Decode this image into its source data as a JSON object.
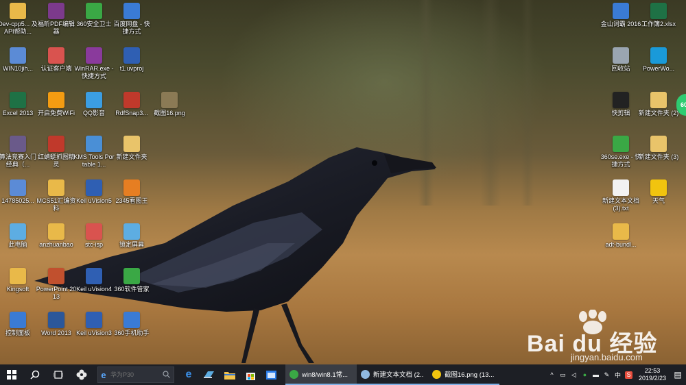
{
  "desktop_icons": [
    {
      "label": "Dev-cpp5...\n及API帮助...",
      "icon": "folder-icon",
      "color": "#e9b949"
    },
    {
      "label": "福昕PDF编辑器",
      "icon": "foxit-pdf-icon",
      "color": "#7c3a8c"
    },
    {
      "label": "360安全卫士",
      "icon": "360-security-icon",
      "color": "#3aa845"
    },
    {
      "label": "百度网盘 - 快捷方式",
      "icon": "baidu-netdisk-icon",
      "color": "#3a7bd5"
    },
    {
      "label": "WIN10jih...",
      "icon": "rar-archive-icon",
      "color": "#5b8bd6"
    },
    {
      "label": "认证客户端",
      "icon": "auth-client-icon",
      "color": "#d9534f"
    },
    {
      "label": "WinRAR.exe - 快捷方式",
      "icon": "winrar-icon",
      "color": "#8a3a9c"
    },
    {
      "label": "t1.uvproj",
      "icon": "keil-project-icon",
      "color": "#2f5fb3"
    },
    {
      "label": "Excel 2013",
      "icon": "excel-icon",
      "color": "#1e7145"
    },
    {
      "label": "开启免费WiFi",
      "icon": "wifi-icon",
      "color": "#f39c12"
    },
    {
      "label": "QQ影音",
      "icon": "qq-player-icon",
      "color": "#3b9ee3"
    },
    {
      "label": "RdfSnap3...",
      "icon": "rdfsnap-icon",
      "color": "#c0392b"
    },
    {
      "label": "截图16.png",
      "icon": "image-file-icon",
      "color": "#8b7a55"
    },
    {
      "label": "算法竞赛入门经典（...",
      "icon": "document-icon",
      "color": "#6a5a8a"
    },
    {
      "label": "红蜻蜓抓图精灵",
      "icon": "dragonfly-icon",
      "color": "#c0392b"
    },
    {
      "label": "KMS Tools Portable 1...",
      "icon": "kms-tools-icon",
      "color": "#4a8fd6"
    },
    {
      "label": "新建文件夹",
      "icon": "folder-icon",
      "color": "#e9c46a"
    },
    {
      "label": "14785025...",
      "icon": "rar-archive-icon",
      "color": "#5b8bd6"
    },
    {
      "label": "MCS51汇编资料",
      "icon": "folder-icon",
      "color": "#e9b949"
    },
    {
      "label": "Keil uVision5",
      "icon": "keil-icon",
      "color": "#2f5fb3"
    },
    {
      "label": "2345看图王",
      "icon": "image-viewer-icon",
      "color": "#e67e22"
    },
    {
      "label": "此电脑",
      "icon": "this-pc-icon",
      "color": "#5dade2"
    },
    {
      "label": "anzhuanbao",
      "icon": "folder-icon",
      "color": "#e9b949"
    },
    {
      "label": "stc-isp",
      "icon": "stc-isp-icon",
      "color": "#d9534f"
    },
    {
      "label": "锁定屏幕",
      "icon": "lock-screen-icon",
      "color": "#5dade2"
    },
    {
      "label": "Kingsoft",
      "icon": "folder-icon",
      "color": "#e9b949"
    },
    {
      "label": "PowerPoint 2013",
      "icon": "powerpoint-icon",
      "color": "#c1502e"
    },
    {
      "label": "Keil uVision4",
      "icon": "keil-icon",
      "color": "#2f5fb3"
    },
    {
      "label": "360软件管家",
      "icon": "360-software-icon",
      "color": "#3aa845"
    },
    {
      "label": "控制面板",
      "icon": "control-panel-icon",
      "color": "#3a7bd5"
    },
    {
      "label": "Word 2013",
      "icon": "word-icon",
      "color": "#2b579a"
    },
    {
      "label": "Keil uVision3",
      "icon": "keil-icon",
      "color": "#2f5fb3"
    },
    {
      "label": "360手机助手",
      "icon": "360-phone-icon",
      "color": "#3a7bd5"
    },
    {
      "label": "金山词霸 2016",
      "icon": "kingsoft-dict-icon",
      "color": "#3a7bd5"
    },
    {
      "label": "工作簿2.xlsx",
      "icon": "excel-file-icon",
      "color": "#1e7145"
    },
    {
      "label": "回收站",
      "icon": "recycle-bin-icon",
      "color": "#9aa5b1"
    },
    {
      "label": "PowerWo...",
      "icon": "powerword-icon",
      "color": "#1a9ad9"
    },
    {
      "label": "快剪辑",
      "icon": "kuaijianji-icon",
      "color": "#222222"
    },
    {
      "label": "新建文件夹 (2)",
      "icon": "folder-icon",
      "color": "#e9c46a"
    },
    {
      "label": "360se.exe - 快捷方式",
      "icon": "360-browser-icon",
      "color": "#3aa845"
    },
    {
      "label": "新建文件夹 (3)",
      "icon": "folder-icon",
      "color": "#e9c46a"
    },
    {
      "label": "新建文本文档 (3).txt",
      "icon": "text-file-icon",
      "color": "#f2f2f2"
    },
    {
      "label": "天气",
      "icon": "weather-icon",
      "color": "#f1c40f"
    },
    {
      "label": "adt-bundl...",
      "icon": "folder-icon",
      "color": "#e9b949"
    }
  ],
  "taskbar": {
    "start_icon": "windows-start-icon",
    "search_placeholder": "华为P30",
    "tasks": [
      {
        "label": "win8/win8.1常...",
        "icon": "360-browser-icon",
        "active": true
      },
      {
        "label": "新建文本文档 (2...",
        "icon": "notepad-icon",
        "active": false
      },
      {
        "label": "截图16.png (13...",
        "icon": "image-viewer-icon",
        "active": false
      }
    ],
    "ime_label": "中",
    "time": "22:53",
    "date": "2019/2/23"
  },
  "watermark": {
    "brand": "Bai du 经验",
    "url": "jingyan.baidu.com"
  },
  "edge_badge": "60"
}
